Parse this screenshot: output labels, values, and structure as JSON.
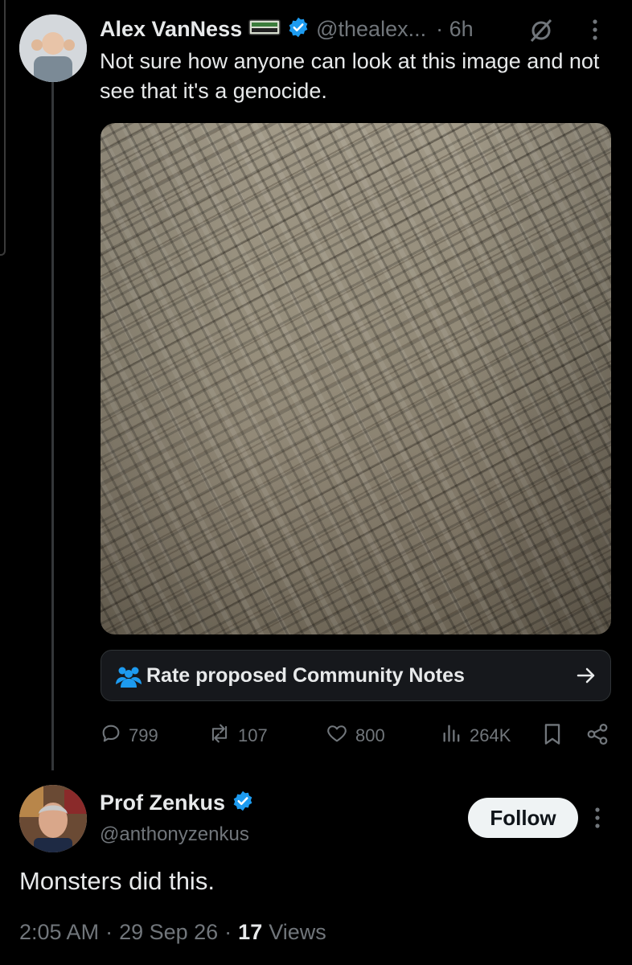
{
  "tweet": {
    "author_name": "Alex VanNess",
    "handle": "@thealex...",
    "time": "· 6h",
    "text": "Not sure how anyone can look at this image and not see that it's a genocide.",
    "community_notes_label": "Rate proposed Community Notes",
    "actions": {
      "replies": "799",
      "reposts": "107",
      "likes": "800",
      "views": "264K"
    }
  },
  "reply": {
    "author_name": "Prof Zenkus",
    "handle": "@anthonyzenkus",
    "follow_label": "Follow",
    "text": "Monsters did this.",
    "time": "2:05 AM",
    "date": "29 Sep 26",
    "views_count": "17",
    "views_label": "Views"
  },
  "colors": {
    "background": "#000000",
    "text_primary": "#e7e9ea",
    "text_muted": "#71767b",
    "verified": "#1d9bf0",
    "community_notes": "#1d9bf0"
  },
  "icons": [
    "reply-icon",
    "repost-icon",
    "like-icon",
    "views-icon",
    "bookmark-icon",
    "share-icon",
    "community-notes-icon",
    "arrow-right-icon",
    "more-icon",
    "grok-icon",
    "verified-badge-icon",
    "ticket-badge-icon"
  ]
}
